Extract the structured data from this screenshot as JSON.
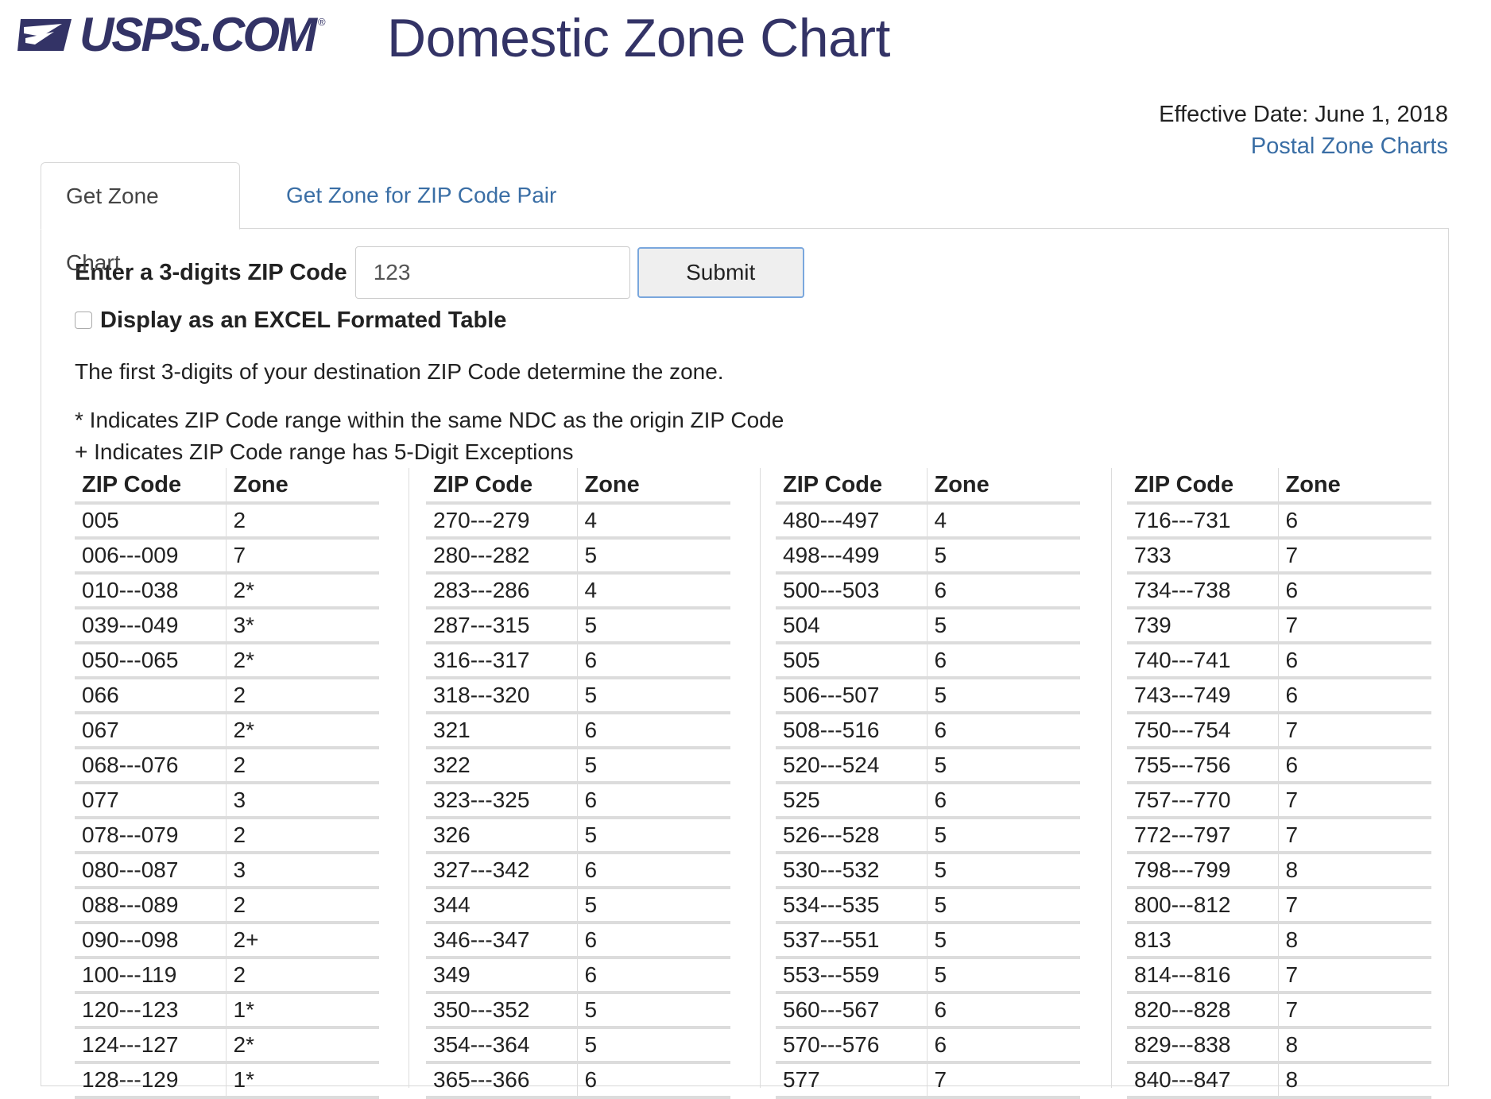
{
  "header": {
    "logo_text": "USPS.COM",
    "logo_reg": "®",
    "title": "Domestic Zone Chart"
  },
  "meta": {
    "effective_date": "Effective Date: June 1, 2018",
    "postal_zone_charts_link": "Postal Zone Charts"
  },
  "tabs": [
    {
      "label": "Get Zone Chart",
      "active": true
    },
    {
      "label": "Get Zone for ZIP Code Pair",
      "active": false
    }
  ],
  "form": {
    "label": "Enter a 3-digits ZIP Code",
    "zip_value": "123",
    "submit_label": "Submit",
    "excel_checkbox_label": "Display as an EXCEL Formated Table",
    "excel_checked": false
  },
  "notes": {
    "line1": "The first 3-digits of your destination ZIP Code determine the zone.",
    "line2": "* Indicates ZIP Code range within the same NDC as the origin ZIP Code",
    "line3": "+ Indicates ZIP Code range has 5-Digit Exceptions"
  },
  "table_headers": {
    "zip": "ZIP Code",
    "zone": "Zone"
  },
  "columns": [
    [
      [
        "005",
        "2"
      ],
      [
        "006---009",
        "7"
      ],
      [
        "010---038",
        "2*"
      ],
      [
        "039---049",
        "3*"
      ],
      [
        "050---065",
        "2*"
      ],
      [
        "066",
        "2"
      ],
      [
        "067",
        "2*"
      ],
      [
        "068---076",
        "2"
      ],
      [
        "077",
        "3"
      ],
      [
        "078---079",
        "2"
      ],
      [
        "080---087",
        "3"
      ],
      [
        "088---089",
        "2"
      ],
      [
        "090---098",
        "2+"
      ],
      [
        "100---119",
        "2"
      ],
      [
        "120---123",
        "1*"
      ],
      [
        "124---127",
        "2*"
      ],
      [
        "128---129",
        "1*"
      ]
    ],
    [
      [
        "270---279",
        "4"
      ],
      [
        "280---282",
        "5"
      ],
      [
        "283---286",
        "4"
      ],
      [
        "287---315",
        "5"
      ],
      [
        "316---317",
        "6"
      ],
      [
        "318---320",
        "5"
      ],
      [
        "321",
        "6"
      ],
      [
        "322",
        "5"
      ],
      [
        "323---325",
        "6"
      ],
      [
        "326",
        "5"
      ],
      [
        "327---342",
        "6"
      ],
      [
        "344",
        "5"
      ],
      [
        "346---347",
        "6"
      ],
      [
        "349",
        "6"
      ],
      [
        "350---352",
        "5"
      ],
      [
        "354---364",
        "5"
      ],
      [
        "365---366",
        "6"
      ]
    ],
    [
      [
        "480---497",
        "4"
      ],
      [
        "498---499",
        "5"
      ],
      [
        "500---503",
        "6"
      ],
      [
        "504",
        "5"
      ],
      [
        "505",
        "6"
      ],
      [
        "506---507",
        "5"
      ],
      [
        "508---516",
        "6"
      ],
      [
        "520---524",
        "5"
      ],
      [
        "525",
        "6"
      ],
      [
        "526---528",
        "5"
      ],
      [
        "530---532",
        "5"
      ],
      [
        "534---535",
        "5"
      ],
      [
        "537---551",
        "5"
      ],
      [
        "553---559",
        "5"
      ],
      [
        "560---567",
        "6"
      ],
      [
        "570---576",
        "6"
      ],
      [
        "577",
        "7"
      ]
    ],
    [
      [
        "716---731",
        "6"
      ],
      [
        "733",
        "7"
      ],
      [
        "734---738",
        "6"
      ],
      [
        "739",
        "7"
      ],
      [
        "740---741",
        "6"
      ],
      [
        "743---749",
        "6"
      ],
      [
        "750---754",
        "7"
      ],
      [
        "755---756",
        "6"
      ],
      [
        "757---770",
        "7"
      ],
      [
        "772---797",
        "7"
      ],
      [
        "798---799",
        "8"
      ],
      [
        "800---812",
        "7"
      ],
      [
        "813",
        "8"
      ],
      [
        "814---816",
        "7"
      ],
      [
        "820---828",
        "7"
      ],
      [
        "829---838",
        "8"
      ],
      [
        "840---847",
        "8"
      ]
    ]
  ],
  "colors": {
    "brand_navy": "#333366",
    "link_blue": "#3a6ea5",
    "border_gray": "#dcdcdc"
  }
}
